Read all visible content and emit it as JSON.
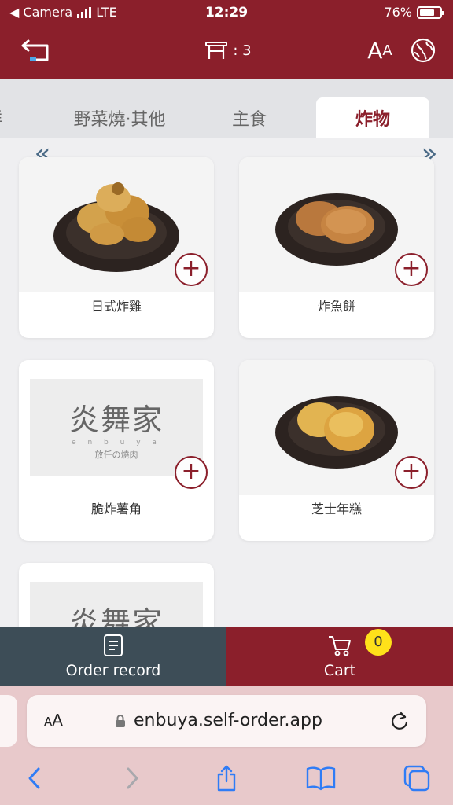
{
  "status_bar": {
    "back_app": "◀ Camera",
    "network": "LTE",
    "time": "12:29",
    "battery_percent": "76%",
    "battery_level": 0.76
  },
  "header": {
    "table_label": ": 3",
    "font_button_big": "A",
    "font_button_small": "A"
  },
  "tabs": [
    {
      "label": "鮮"
    },
    {
      "label": "野菜燒·其他"
    },
    {
      "label": "主食"
    },
    {
      "label": "炸物",
      "active": true
    }
  ],
  "arrows": {
    "left": "«",
    "right": "»"
  },
  "products": [
    {
      "name": "日式炸雞",
      "image": "karaage-photo"
    },
    {
      "name": "炸魚餅",
      "image": "fishcake-photo"
    },
    {
      "name": "脆炸薯角",
      "image": "logo-placeholder"
    },
    {
      "name": "芝士年糕",
      "image": "cheese-ricecake-photo"
    },
    {
      "name": "",
      "image": "logo-placeholder"
    }
  ],
  "logo_placeholder": {
    "main": "炎舞家",
    "sub1": "e n b u y a",
    "sub2": "放任の燒肉"
  },
  "add_button_symbol": "+",
  "action_bar": {
    "order_record_label": "Order record",
    "cart_label": "Cart",
    "cart_count": "0"
  },
  "browser": {
    "aa_big": "A",
    "aa_small": "A",
    "url": "enbuya.self-order.app"
  },
  "colors": {
    "brand": "#8b1f2b",
    "order_bar": "#3d4d57",
    "badge": "#ffe11a",
    "ios_blue": "#2f7cf6"
  }
}
